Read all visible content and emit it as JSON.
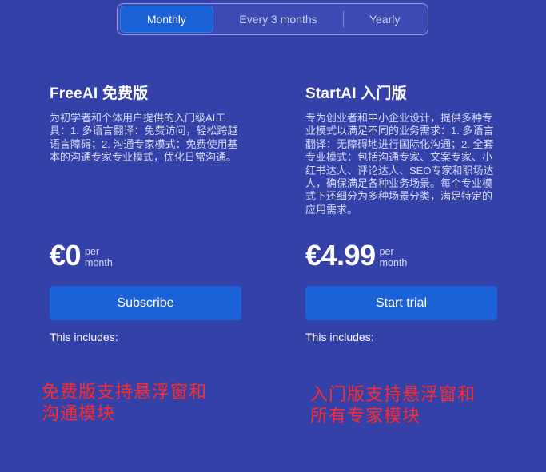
{
  "billing_toggle": {
    "options": [
      {
        "label": "Monthly",
        "active": true
      },
      {
        "label": "Every 3 months",
        "active": false
      },
      {
        "label": "Yearly",
        "active": false
      }
    ]
  },
  "plans": [
    {
      "name": "FreeAI 免费版",
      "description": "为初学者和个体用户提供的入门级AI工具：1. 多语言翻译：免费访问，轻松跨越语言障碍；2. 沟通专家模式：免费使用基本的沟通专家专业模式，优化日常沟通。",
      "price": "€0",
      "price_unit_line1": "per",
      "price_unit_line2": "month",
      "cta_label": "Subscribe",
      "includes_label": "This includes:"
    },
    {
      "name": "StartAI 入门版",
      "description": "专为创业者和中小企业设计，提供多种专业模式以满足不同的业务需求：1. 多语言翻译：无障碍地进行国际化沟通；2. 全套专业模式：包括沟通专家、文案专家、小红书达人、评论达人、SEO专家和职场达人，确保满足各种业务场景。每个专业模式下还细分为多种场景分类，满足特定的应用需求。",
      "price": "€4.99",
      "price_unit_line1": "per",
      "price_unit_line2": "month",
      "cta_label": "Start trial",
      "includes_label": "This includes:"
    }
  ],
  "annotations": {
    "free": {
      "line1": "免费版支持悬浮窗和",
      "line2": "沟通模块"
    },
    "start": {
      "line1": "入门版支持悬浮窗和",
      "line2": "所有专家模块"
    }
  },
  "colors": {
    "background": "#3441a8",
    "accent": "#1b62d9",
    "annotation": "#ff2b2b"
  }
}
